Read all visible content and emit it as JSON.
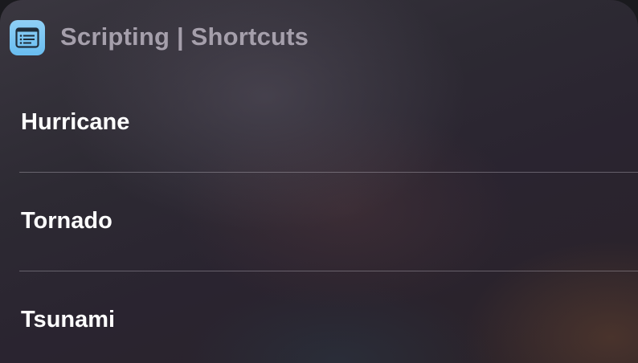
{
  "header": {
    "title": "Scripting | Shortcuts",
    "app_icon": "scripting-app-icon"
  },
  "list": {
    "items": [
      {
        "label": "Hurricane"
      },
      {
        "label": "Tornado"
      },
      {
        "label": "Tsunami"
      }
    ]
  },
  "colors": {
    "icon_background": "#7ac8f4",
    "title_text": "#a59fab",
    "item_text": "#ffffff",
    "divider": "#6e6a72"
  }
}
